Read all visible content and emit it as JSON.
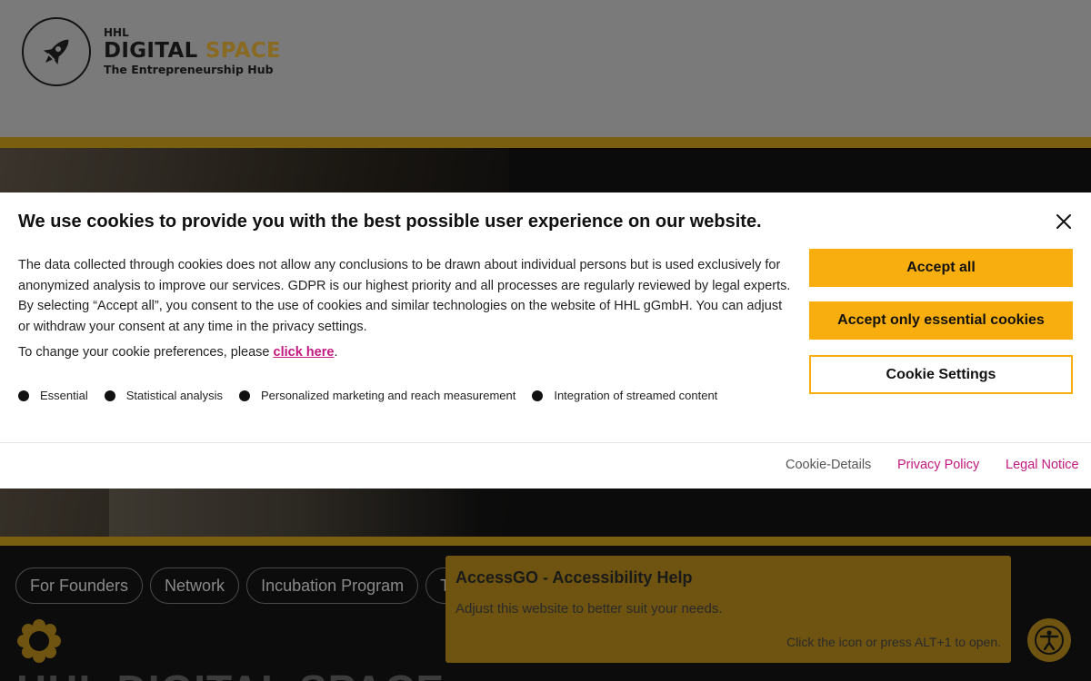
{
  "logo": {
    "small": "HHL",
    "big_main": "DIGITAL",
    "big_accent": "SPACE",
    "sub": "The Entrepreneurship Hub"
  },
  "nav_pills": [
    "For Founders",
    "Network",
    "Incubation Program",
    "Tra"
  ],
  "hero_title": "HHL DIGITAL SPACE",
  "cookie": {
    "title": "We use cookies to provide you with the best possible user experience on our website.",
    "body": "The data collected through cookies does not allow any conclusions to be drawn about individual persons but is used exclusively for anonymized analysis to improve our services. GDPR is our highest priority and all processes are regularly reviewed by legal experts. By selecting “Accept all”, you consent to the use of cookies and similar technologies on the website of HHL gGmbH. You can adjust or withdraw your consent at any time in the privacy settings.",
    "prefs_text": "To change your cookie preferences, please ",
    "prefs_link": "click here",
    "prefs_end": ".",
    "categories": [
      "Essential",
      "Statistical analysis",
      "Personalized marketing and reach measurement",
      "Integration of streamed content"
    ],
    "buttons": {
      "accept_all": "Accept all",
      "accept_essential": "Accept only essential cookies",
      "settings": "Cookie Settings"
    },
    "footer": {
      "details": "Cookie-Details",
      "privacy": "Privacy Policy",
      "legal": "Legal Notice"
    }
  },
  "accessgo": {
    "title": "AccessGO - Accessibility Help",
    "text": "Adjust this website to better suit your needs.",
    "hint": "Click the icon or press ALT+1 to open."
  },
  "colors": {
    "accent": "#f8ae0e",
    "link": "#c2187f"
  }
}
